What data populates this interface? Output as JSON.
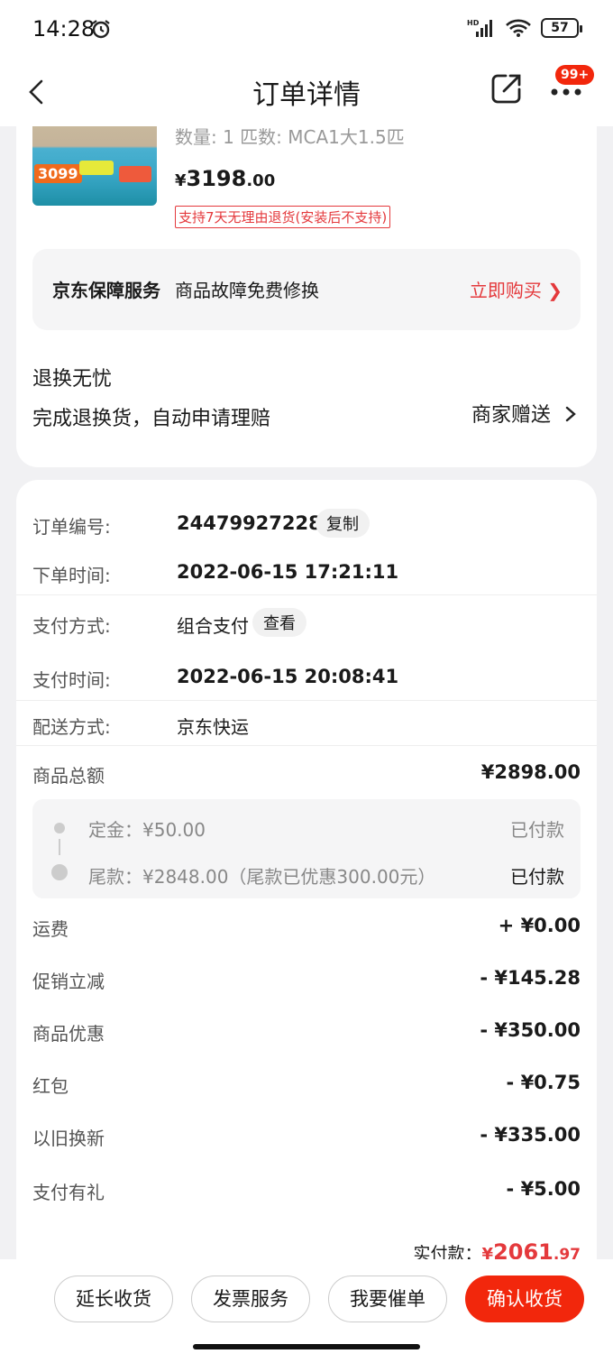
{
  "status": {
    "time": "14:28",
    "battery": "57",
    "net": "HD"
  },
  "nav": {
    "title": "订单详情",
    "badge": "99+"
  },
  "product": {
    "spec": "数量: 1  匹数: MCA1大1.5匹",
    "thumb_price": "3099",
    "price_yen": "¥",
    "price_int": "3198",
    "price_dec": ".00",
    "return_tag": "支持7天无理由退货(安装后不支持)"
  },
  "guarantee": {
    "title": "京东保障服务",
    "desc": "商品故障免费修换",
    "action": "立即购买 ❯"
  },
  "worry": {
    "title": "退换无忧",
    "desc": "完成退换货，自动申请理赔",
    "gift": "商家赠送"
  },
  "order": {
    "no_label": "订单编号:",
    "no_value": "244799272286",
    "copy": "复制",
    "time_label": "下单时间:",
    "time_value": "2022-06-15 17:21:11",
    "pay_label": "支付方式:",
    "pay_value": "组合支付",
    "view": "查看",
    "paytime_label": "支付时间:",
    "paytime_value": "2022-06-15 20:08:41",
    "ship_label": "配送方式:",
    "ship_value": "京东快运"
  },
  "amounts": {
    "total_label": "商品总额",
    "total_value": "¥2898.00",
    "deposit_label": "定金：¥50.00",
    "deposit_status": "已付款",
    "balance_label": "尾款：¥2848.00（尾款已优惠300.00元）",
    "balance_status": "已付款",
    "items": [
      {
        "label": "运费",
        "value": "+ ¥0.00"
      },
      {
        "label": "促销立减",
        "value": "- ¥145.28"
      },
      {
        "label": "商品优惠",
        "value": "- ¥350.00"
      },
      {
        "label": "红包",
        "value": "- ¥0.75"
      },
      {
        "label": "以旧换新",
        "value": "- ¥335.00"
      },
      {
        "label": "支付有礼",
        "value": "- ¥5.00"
      }
    ],
    "paid_label": "实付款：",
    "paid_yen": "¥",
    "paid_int": "2061",
    "paid_dec": ".97"
  },
  "actions": {
    "extend": "延长收货",
    "invoice": "发票服务",
    "urge": "我要催单",
    "confirm": "确认收货"
  },
  "colors": {
    "accent": "#f2270c",
    "price_red": "#e4393c"
  }
}
